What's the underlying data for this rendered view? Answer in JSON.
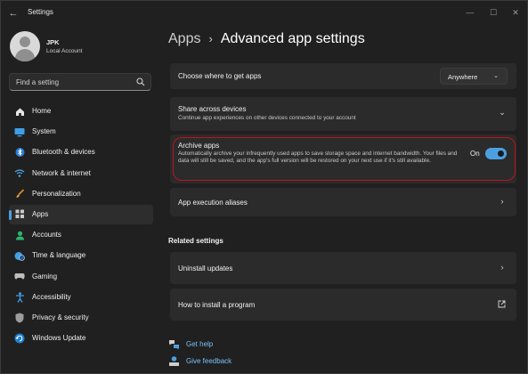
{
  "window": {
    "title": "Settings",
    "back_glyph": "←",
    "min_glyph": "—",
    "max_glyph": "☐",
    "close_glyph": "✕"
  },
  "profile": {
    "name": "JPK",
    "subtitle": "Local Account"
  },
  "search": {
    "placeholder": "Find a setting"
  },
  "sidebar": {
    "items": [
      {
        "label": "Home",
        "icon": "home-icon",
        "active": false
      },
      {
        "label": "System",
        "icon": "system-icon",
        "active": false
      },
      {
        "label": "Bluetooth & devices",
        "icon": "bluetooth-icon",
        "active": false
      },
      {
        "label": "Network & internet",
        "icon": "network-icon",
        "active": false
      },
      {
        "label": "Personalization",
        "icon": "brush-icon",
        "active": false
      },
      {
        "label": "Apps",
        "icon": "apps-icon",
        "active": true
      },
      {
        "label": "Accounts",
        "icon": "accounts-icon",
        "active": false
      },
      {
        "label": "Time & language",
        "icon": "globe-clock-icon",
        "active": false
      },
      {
        "label": "Gaming",
        "icon": "gamepad-icon",
        "active": false
      },
      {
        "label": "Accessibility",
        "icon": "accessibility-icon",
        "active": false
      },
      {
        "label": "Privacy & security",
        "icon": "shield-icon",
        "active": false
      },
      {
        "label": "Windows Update",
        "icon": "update-icon",
        "active": false
      }
    ]
  },
  "breadcrumb": {
    "parent": "Apps",
    "separator": "›",
    "current": "Advanced app settings"
  },
  "cards": {
    "where_to_get": {
      "title": "Choose where to get apps",
      "value": "Anywhere",
      "chevron": "⌄"
    },
    "share": {
      "title": "Share across devices",
      "description": "Continue app experiences on other devices connected to your account",
      "chevron": "⌄"
    },
    "archive": {
      "title": "Archive apps",
      "description": "Automatically archive your infrequently used apps to save storage space and internet bandwidth. Your files and data will still be saved, and the app's full version will be restored on your next use if it's still available.",
      "toggle_label": "On",
      "toggle_on": true
    },
    "aliases": {
      "title": "App execution aliases",
      "chevron": "›"
    }
  },
  "related": {
    "header": "Related settings",
    "uninstall": {
      "title": "Uninstall updates",
      "chevron": "›"
    },
    "install_program": {
      "title": "How to install a program",
      "icon": "external-link-icon"
    }
  },
  "links": {
    "help": "Get help",
    "feedback": "Give feedback"
  },
  "colors": {
    "accent": "#4ca0e0",
    "highlight": "#c0121f",
    "link": "#7cc0f5"
  }
}
